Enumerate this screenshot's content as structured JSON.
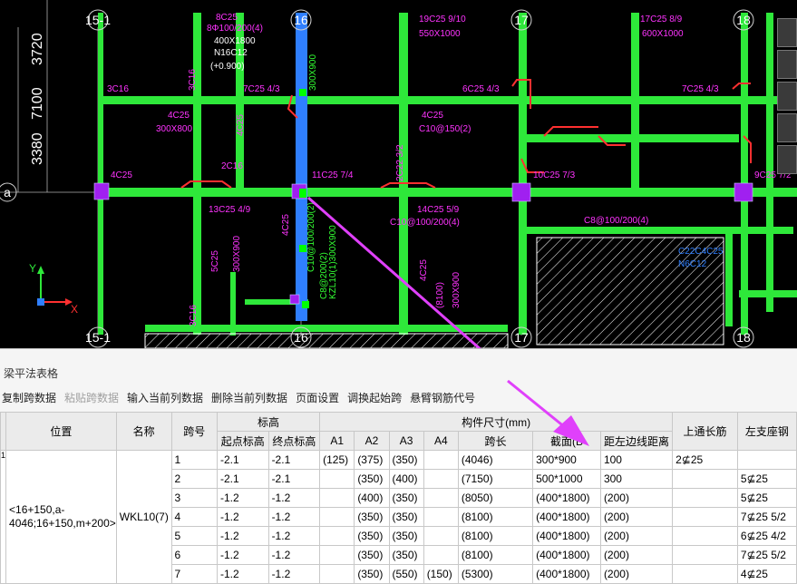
{
  "drawing": {
    "axis_labels": {
      "col_15_1": "15-1",
      "col_16": "16",
      "col_17": "17",
      "col_18": "18",
      "row_a": "a"
    },
    "dims_left": [
      "3720",
      "7100",
      "3380"
    ],
    "ucs": {
      "x": "X",
      "y": "Y"
    },
    "annotations": [
      "8C25",
      "8Φ100/200(4)",
      "400X1800",
      "N16C12",
      "(+0.900)",
      "19C25 9/10",
      "550X1000",
      "17C25 8/9",
      "600X1000",
      "3C16",
      "3C16",
      "7C25 4/3",
      "6C25 4/3",
      "7C25 4/3",
      "4C25",
      "4C25",
      "300X800",
      "4C25",
      "C10@150(2)",
      "4C25",
      "2C16",
      "11C25 7/4",
      "2C22 3/2",
      "10C25 7/3",
      "9C25 7/2",
      "13C25 4/9",
      "14C25 5/9",
      "C10@100/200(4)",
      "C8@100/200(4)",
      "5C25",
      "300X900",
      "4C25",
      "300X900",
      "C10@100/200(2)",
      "4C25",
      "(8100)",
      "300X900",
      "3C16",
      "KZL10(1)300X900",
      "C8@200(2)",
      "C22C4C25",
      "N6C12"
    ]
  },
  "panel": {
    "title": "梁平法表格",
    "toolbar": [
      "复制跨数据",
      "粘贴跨数据",
      "输入当前列数据",
      "删除当前列数据",
      "页面设置",
      "调换起始跨",
      "悬臂钢筋代号"
    ],
    "headers": {
      "position": "位置",
      "name": "名称",
      "span_no": "跨号",
      "elevation": "标高",
      "start_elev": "起点标高",
      "end_elev": "终点标高",
      "size": "构件尺寸(mm)",
      "a1": "A1",
      "a2": "A2",
      "a3": "A3",
      "a4": "A4",
      "span_len": "跨长",
      "section": "截面(B",
      "left_dist": "距左边线距离",
      "top_long": "上通长筋",
      "left_support": "左支座钢"
    },
    "position_value": "<16+150,a-4046;16+150,m+200>",
    "name_value": "WKL10(7)",
    "row_marker": "1",
    "rows": [
      {
        "span": "1",
        "start": "-2.1",
        "end": "-2.1",
        "a1": "(125)",
        "a2": "(375)",
        "a3": "(350)",
        "a4": "",
        "len": "(4046)",
        "sec": "300*900",
        "dist": "100",
        "top": "2⊈25",
        "left": ""
      },
      {
        "span": "2",
        "start": "-2.1",
        "end": "-2.1",
        "a1": "",
        "a2": "(350)",
        "a3": "(400)",
        "a4": "",
        "len": "(7150)",
        "sec": "500*1000",
        "dist": "300",
        "top": "",
        "left": "5⊈25"
      },
      {
        "span": "3",
        "start": "-1.2",
        "end": "-1.2",
        "a1": "",
        "a2": "(400)",
        "a3": "(350)",
        "a4": "",
        "len": "(8050)",
        "sec": "(400*1800)",
        "dist": "(200)",
        "top": "",
        "left": "5⊈25"
      },
      {
        "span": "4",
        "start": "-1.2",
        "end": "-1.2",
        "a1": "",
        "a2": "(350)",
        "a3": "(350)",
        "a4": "",
        "len": "(8100)",
        "sec": "(400*1800)",
        "dist": "(200)",
        "top": "",
        "left": "7⊈25 5/2"
      },
      {
        "span": "5",
        "start": "-1.2",
        "end": "-1.2",
        "a1": "",
        "a2": "(350)",
        "a3": "(350)",
        "a4": "",
        "len": "(8100)",
        "sec": "(400*1800)",
        "dist": "(200)",
        "top": "",
        "left": "6⊈25 4/2"
      },
      {
        "span": "6",
        "start": "-1.2",
        "end": "-1.2",
        "a1": "",
        "a2": "(350)",
        "a3": "(350)",
        "a4": "",
        "len": "(8100)",
        "sec": "(400*1800)",
        "dist": "(200)",
        "top": "",
        "left": "7⊈25 5/2"
      },
      {
        "span": "7",
        "start": "-1.2",
        "end": "-1.2",
        "a1": "",
        "a2": "(350)",
        "a3": "(550)",
        "a4": "(150)",
        "len": "(5300)",
        "sec": "(400*1800)",
        "dist": "(200)",
        "top": "",
        "left": "4⊈25"
      }
    ]
  },
  "colors": {
    "cad_bg": "#000000",
    "beam": "#2ee83a",
    "selected_beam": "#2f7fff",
    "column": "#a020f0",
    "rebar": "#ff3030",
    "text_magenta": "#ff33ff",
    "text_green": "#33ff33",
    "arrow": "#e040fb"
  }
}
